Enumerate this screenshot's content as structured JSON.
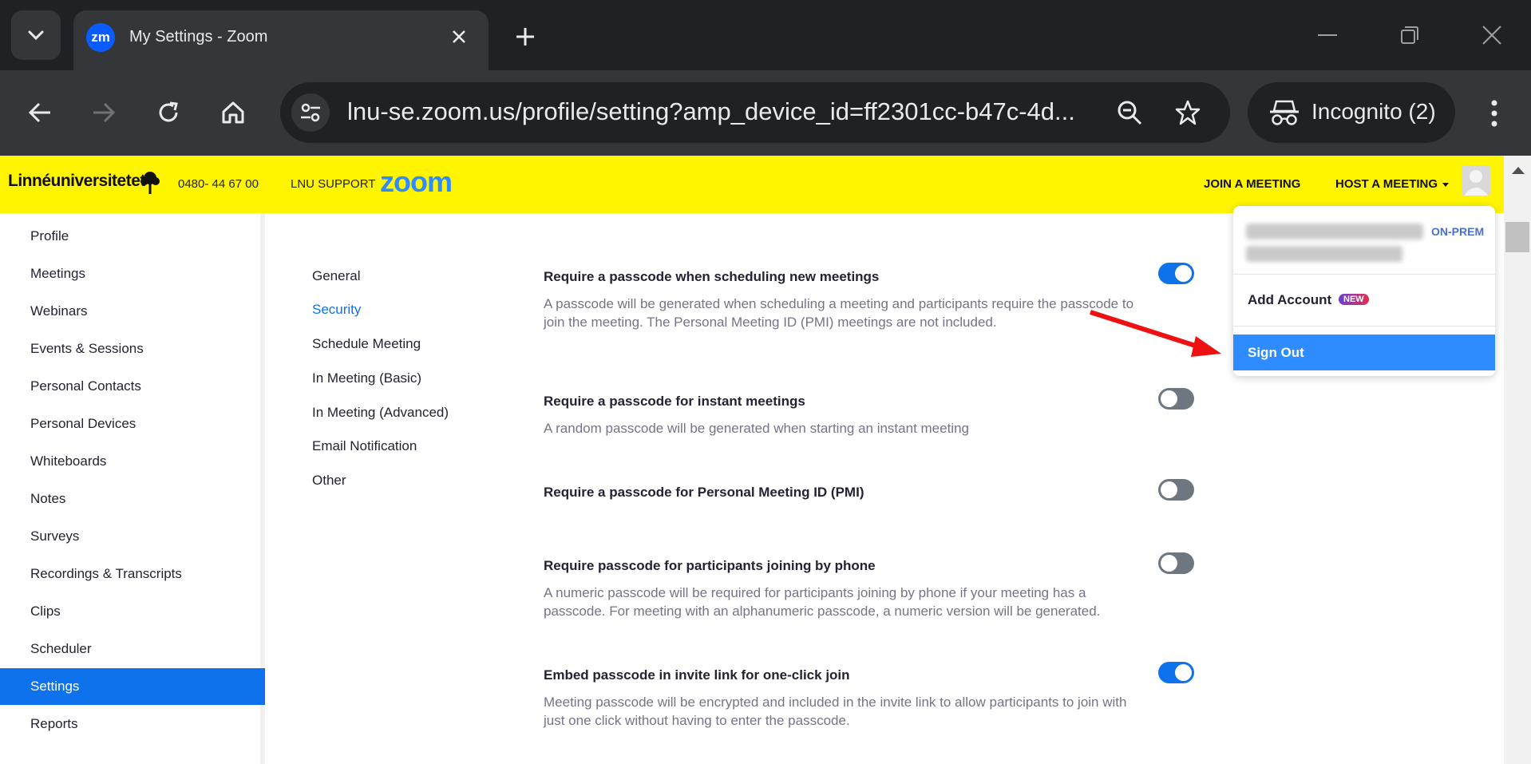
{
  "browser": {
    "tab_title": "My Settings - Zoom",
    "tab_favicon": "zm",
    "url": "lnu-se.zoom.us/profile/setting?amp_device_id=ff2301cc-b47c-4d...",
    "incognito_label": "Incognito (2)"
  },
  "header": {
    "org_name": "Linnéuniversitetet",
    "phone": "0480- 44 67 00",
    "support": "LNU SUPPORT",
    "brand": "zoom",
    "join": "JOIN A MEETING",
    "host": "HOST A MEETING"
  },
  "sidebar": {
    "items": [
      {
        "label": "Profile"
      },
      {
        "label": "Meetings"
      },
      {
        "label": "Webinars"
      },
      {
        "label": "Events & Sessions"
      },
      {
        "label": "Personal Contacts"
      },
      {
        "label": "Personal Devices"
      },
      {
        "label": "Whiteboards"
      },
      {
        "label": "Notes"
      },
      {
        "label": "Surveys"
      },
      {
        "label": "Recordings & Transcripts"
      },
      {
        "label": "Clips"
      },
      {
        "label": "Scheduler"
      },
      {
        "label": "Settings",
        "active": true
      },
      {
        "label": "Reports"
      }
    ]
  },
  "subnav": {
    "items": [
      {
        "label": "General"
      },
      {
        "label": "Security",
        "active": true
      },
      {
        "label": "Schedule Meeting"
      },
      {
        "label": "In Meeting (Basic)"
      },
      {
        "label": "In Meeting (Advanced)"
      },
      {
        "label": "Email Notification"
      },
      {
        "label": "Other"
      }
    ]
  },
  "settings": [
    {
      "title": "Require a passcode when scheduling new meetings",
      "description": "A passcode will be generated when scheduling a meeting and participants require the passcode to join the meeting. The Personal Meeting ID (PMI) meetings are not included.",
      "enabled": true
    },
    {
      "title": "Require a passcode for instant meetings",
      "description": "A random passcode will be generated when starting an instant meeting",
      "enabled": false
    },
    {
      "title": "Require a passcode for Personal Meeting ID (PMI)",
      "description": "",
      "enabled": false
    },
    {
      "title": "Require passcode for participants joining by phone",
      "description": "A numeric passcode will be required for participants joining by phone if your meeting has a passcode. For meeting with an alphanumeric passcode, a numeric version will be generated.",
      "enabled": false
    },
    {
      "title": "Embed passcode in invite link for one-click join",
      "description": "Meeting passcode will be encrypted and included in the invite link to allow participants to join with just one click without having to enter the passcode.",
      "enabled": true
    }
  ],
  "account_menu": {
    "account_type": "ON-PREM",
    "add_account": "Add Account",
    "new_badge": "NEW",
    "sign_out": "Sign Out"
  },
  "colors": {
    "header_bg": "#fff500",
    "accent": "#0e72ed",
    "zoom_blue": "#2d8cff",
    "annotation_arrow": "#ee1111"
  },
  "icons": [
    "tab-list-icon",
    "close-icon",
    "plus-icon",
    "minimize-icon",
    "restore-icon",
    "back-icon",
    "forward-icon",
    "reload-icon",
    "home-icon",
    "site-info-icon",
    "zoom-page-icon",
    "bookmark-star-icon",
    "incognito-icon",
    "more-vert-icon"
  ]
}
